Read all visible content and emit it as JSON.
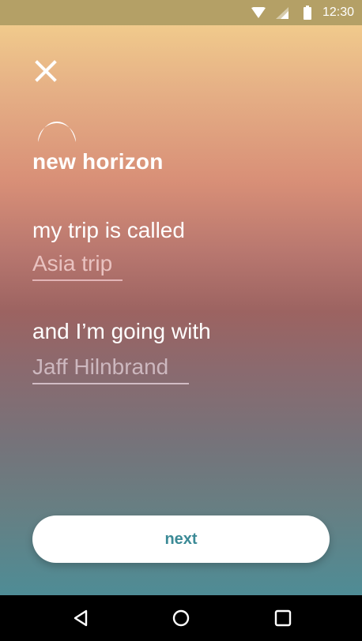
{
  "status_bar": {
    "time": "12:30",
    "icons": [
      "wifi-icon",
      "signal-icon",
      "battery-icon"
    ]
  },
  "header": {
    "close_icon": "close-icon",
    "logo_icon": "horizon-logo-icon",
    "app_title": "new horizon"
  },
  "form": {
    "trip_prompt": "my trip is called",
    "trip_name": "Asia trip",
    "companion_prompt": "and I’m going with",
    "companion_name": "Jaff Hilnbrand"
  },
  "actions": {
    "next_label": "next"
  },
  "nav_bar": {
    "icons": [
      "back-icon",
      "home-icon",
      "recents-icon"
    ]
  },
  "colors": {
    "gradient_top": "#f5d48e",
    "gradient_middle": "#9c6361",
    "gradient_bottom": "#4f8c95",
    "status_bar": "#b4a066",
    "button_text": "#3b8a96",
    "field_text": "#e9c2c0"
  }
}
